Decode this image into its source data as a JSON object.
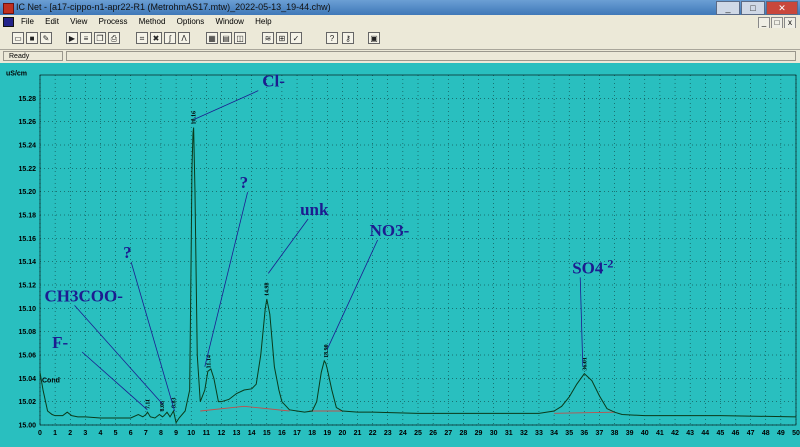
{
  "window": {
    "title": "IC Net - [a17-cippo-n1-apr22-R1 (MetrohmAS17.mtw)_2022-05-13_19-44.chw)",
    "min": "_",
    "max": "□",
    "close": "✕"
  },
  "menu": {
    "items": [
      "File",
      "Edit",
      "View",
      "Process",
      "Method",
      "Options",
      "Window",
      "Help"
    ],
    "mdi_controls": [
      "_",
      "□",
      "x"
    ]
  },
  "toolbar": {
    "buttons": [
      {
        "icon": "open-folder-icon"
      },
      {
        "icon": "save-icon"
      },
      {
        "icon": "edit-icon"
      },
      {
        "icon": "run-icon"
      },
      {
        "icon": "report-icon"
      },
      {
        "icon": "copy-icon"
      },
      {
        "icon": "print-icon"
      },
      {
        "icon": "calibration-icon"
      },
      {
        "icon": "stop-icon"
      },
      {
        "icon": "integrate-icon"
      },
      {
        "icon": "peak-icon"
      },
      {
        "icon": "window-tile-icon"
      },
      {
        "icon": "window-cascade-icon"
      },
      {
        "icon": "window-split-icon"
      },
      {
        "icon": "overlay-icon"
      },
      {
        "icon": "zoom-icon"
      },
      {
        "icon": "check-icon"
      },
      {
        "icon": "help-icon"
      },
      {
        "icon": "key-icon"
      },
      {
        "icon": "monitor-icon"
      }
    ]
  },
  "status": {
    "text": "Ready"
  },
  "chart_data": {
    "type": "line",
    "ylabel": "uS/cm",
    "curve_label": "Cond",
    "ylim": [
      15.0,
      15.3
    ],
    "xlim": [
      0,
      50
    ],
    "y_ticks": [
      "15.28",
      "15.26",
      "15.24",
      "15.22",
      "15.20",
      "15.18",
      "15.16",
      "15.14",
      "15.12",
      "15.10",
      "15.08",
      "15.06",
      "15.04",
      "15.02",
      "15.00"
    ],
    "y_tick_values": [
      15.28,
      15.26,
      15.24,
      15.22,
      15.2,
      15.18,
      15.16,
      15.14,
      15.12,
      15.1,
      15.08,
      15.06,
      15.04,
      15.02,
      15.0
    ],
    "x_ticks": [
      0,
      1,
      2,
      3,
      4,
      5,
      6,
      7,
      8,
      9,
      10,
      11,
      12,
      13,
      14,
      15,
      16,
      17,
      18,
      19,
      20,
      21,
      22,
      23,
      24,
      25,
      26,
      27,
      28,
      29,
      30,
      31,
      32,
      33,
      34,
      35,
      36,
      37,
      38,
      39,
      40,
      41,
      42,
      43,
      44,
      45,
      46,
      47,
      48,
      49,
      50
    ],
    "grid": true,
    "series": [
      {
        "x": [
          0,
          0.2,
          0.5,
          0.8,
          1,
          1.5,
          1.8,
          2.1,
          2.5,
          3,
          4,
          5,
          6,
          6.5,
          6.8,
          7,
          7.11,
          7.3,
          7.6,
          7.9,
          8.1,
          8.2,
          8.4,
          8.6,
          8.83,
          9,
          9.2,
          9.6,
          9.9,
          10.0,
          10.05,
          10.12,
          10.16,
          10.25,
          10.4,
          10.6,
          10.9,
          11.1,
          11.3,
          11.5,
          11.8,
          12,
          12.5,
          13,
          13.5,
          14,
          14.3,
          14.6,
          14.9,
          15.0,
          15.2,
          15.5,
          15.8,
          16,
          16.5,
          17,
          17.5,
          18,
          18.3,
          18.6,
          18.8,
          18.9,
          19.0,
          19.3,
          19.6,
          20,
          21,
          22,
          25,
          30,
          33,
          34,
          34.5,
          35,
          35.5,
          36.0,
          36.5,
          37,
          37.5,
          38,
          38.5,
          40,
          45,
          50
        ],
        "y": [
          15.045,
          15.03,
          15.012,
          15.009,
          15.008,
          15.008,
          15.011,
          15.008,
          15.007,
          15.007,
          15.006,
          15.006,
          15.006,
          15.009,
          15.007,
          15.009,
          15.011,
          15.007,
          15.006,
          15.009,
          15.007,
          15.008,
          15.011,
          15.007,
          15.012,
          15.002,
          15.006,
          15.012,
          15.03,
          15.15,
          15.22,
          15.25,
          15.255,
          15.2,
          15.06,
          15.02,
          15.03,
          15.046,
          15.048,
          15.04,
          15.02,
          15.02,
          15.022,
          15.027,
          15.03,
          15.031,
          15.035,
          15.06,
          15.1,
          15.108,
          15.095,
          15.05,
          15.03,
          15.02,
          15.013,
          15.012,
          15.011,
          15.012,
          15.02,
          15.045,
          15.055,
          15.053,
          15.048,
          15.03,
          15.015,
          15.012,
          15.011,
          15.011,
          15.01,
          15.01,
          15.01,
          15.012,
          15.016,
          15.024,
          15.035,
          15.044,
          15.038,
          15.025,
          15.014,
          15.011,
          15.009,
          15.008,
          15.008,
          15.007
        ]
      }
    ],
    "retention_labels": [
      {
        "text": "7.11",
        "x": 7.11,
        "y": 15.011
      },
      {
        "text": "8.08",
        "x": 8.08,
        "y": 15.009
      },
      {
        "text": "8.83",
        "x": 8.83,
        "y": 15.012
      },
      {
        "text": "10.16",
        "x": 10.16,
        "y": 15.255
      },
      {
        "text": "11.14",
        "x": 11.14,
        "y": 15.046
      },
      {
        "text": "14.98",
        "x": 14.98,
        "y": 15.108
      },
      {
        "text": "18.90",
        "x": 18.9,
        "y": 15.055
      },
      {
        "text": "36.01",
        "x": 36.01,
        "y": 15.044
      }
    ],
    "annotations": [
      {
        "text": "Cl-",
        "x": 14.7,
        "y": 15.29,
        "tx": 10.2,
        "ty": 15.262
      },
      {
        "text": "?",
        "x": 13.2,
        "y": 15.203,
        "tx": 10.9,
        "ty": 15.05
      },
      {
        "text": "unk",
        "x": 17.2,
        "y": 15.18,
        "tx": 15.1,
        "ty": 15.13
      },
      {
        "text": "NO3-",
        "x": 21.8,
        "y": 15.162,
        "tx": 19.0,
        "ty": 15.065
      },
      {
        "text": "?",
        "x": 5.5,
        "y": 15.143,
        "tx": 8.9,
        "ty": 15.012
      },
      {
        "text": "CH3COO-",
        "x": 0.3,
        "y": 15.106,
        "tx": 8.1,
        "ty": 15.018
      },
      {
        "text": "F-",
        "x": 0.8,
        "y": 15.066,
        "tx": 7.1,
        "ty": 15.013
      },
      {
        "text": "SO4",
        "x": 35.2,
        "y": 15.13,
        "tx": 35.9,
        "ty": 15.05
      }
    ],
    "annotation_superscript": "-2",
    "baseline_color": "#c0504d",
    "trace_color": "#0a3a1a",
    "background_color": "#29bfbf"
  }
}
